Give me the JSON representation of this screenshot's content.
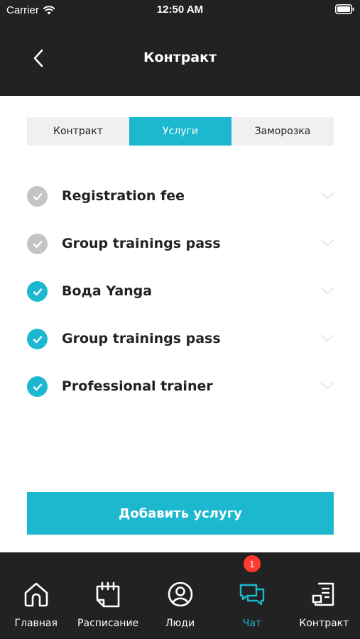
{
  "status_bar": {
    "carrier": "Carrier",
    "time": "12:50 AM"
  },
  "header": {
    "title": "Контракт"
  },
  "segments": [
    {
      "label": "Контракт",
      "active": false
    },
    {
      "label": "Услуги",
      "active": true
    },
    {
      "label": "Заморозка",
      "active": false
    }
  ],
  "services": [
    {
      "name": "Registration fee",
      "status": "pending"
    },
    {
      "name": "Group trainings pass",
      "status": "pending"
    },
    {
      "name": "Вода Yanga",
      "status": "done"
    },
    {
      "name": "Group trainings pass",
      "status": "done"
    },
    {
      "name": "Professional trainer",
      "status": "done"
    }
  ],
  "add_button": {
    "label": "Добавить услугу"
  },
  "tabs": [
    {
      "label": "Главная",
      "icon": "home-icon",
      "active": false
    },
    {
      "label": "Расписание",
      "icon": "calendar-icon",
      "active": false
    },
    {
      "label": "Люди",
      "icon": "person-icon",
      "active": false
    },
    {
      "label": "Чат",
      "icon": "chat-icon",
      "active": true,
      "badge": "1"
    },
    {
      "label": "Контракт",
      "icon": "document-icon",
      "active": false
    }
  ],
  "colors": {
    "accent": "#1bb8cf",
    "dark": "#222222",
    "pending": "#c4c4c4",
    "badge": "#ff3b30"
  }
}
